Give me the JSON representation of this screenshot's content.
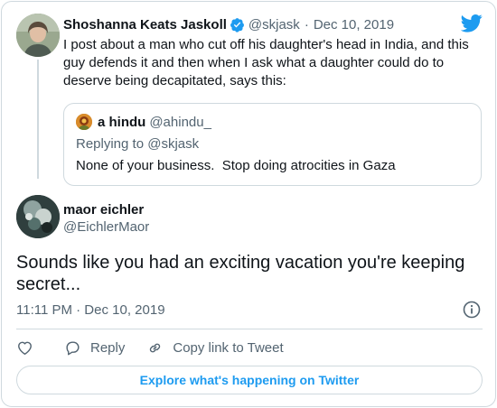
{
  "colors": {
    "brand_blue": "#1d9bf0",
    "text_primary": "#0f1419",
    "text_secondary": "#536471",
    "border": "#cfd9de"
  },
  "icons": {
    "brand": "twitter-bird-icon",
    "verified": "verified-badge-icon",
    "like": "heart-icon",
    "reply": "reply-bubble-icon",
    "copy": "link-icon",
    "info": "info-icon"
  },
  "parent_tweet": {
    "author_name": "Shoshanna Keats Jaskoll",
    "handle": "@skjask",
    "separator": "·",
    "date": "Dec 10, 2019",
    "text": "I post about a man who cut off his daughter's head in India, and this guy defends it and then when I ask what a daughter could do to deserve being decapitated, says this:"
  },
  "quoted_tweet": {
    "author_name": "a hindu",
    "handle": "@ahindu_",
    "replying_to": "Replying to @skjask",
    "text": "None of your business.  Stop doing atrocities in Gaza"
  },
  "main_tweet": {
    "author_name": "maor eichler",
    "handle": "@EichlerMaor",
    "text": "Sounds like you had an exciting vacation you're keeping secret...",
    "timestamp": "11:11 PM · Dec 10, 2019"
  },
  "actions": {
    "reply_label": "Reply",
    "copy_label": "Copy link to Tweet"
  },
  "footer": {
    "explore_label": "Explore what's happening on Twitter"
  }
}
